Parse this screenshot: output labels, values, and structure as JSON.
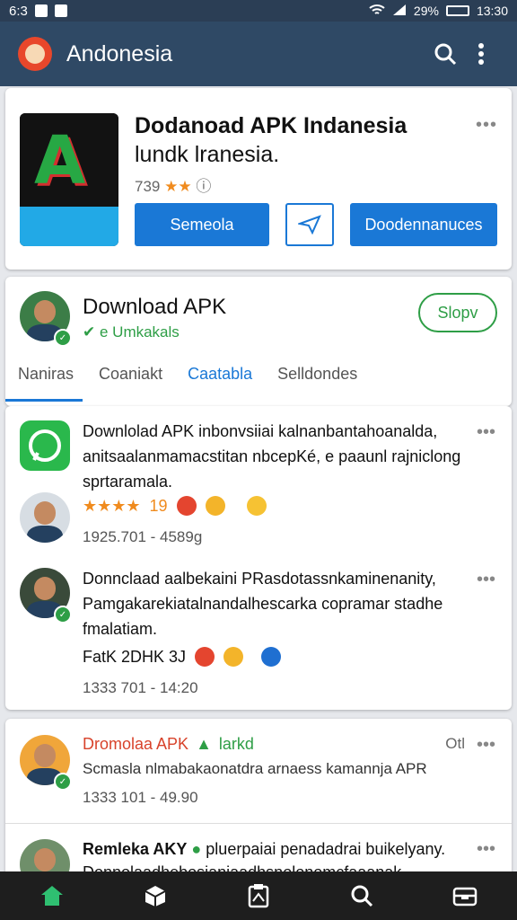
{
  "status_bar": {
    "left": "6:3",
    "battery": "29%",
    "time": "13:30"
  },
  "app_bar": {
    "title": "Andonesia"
  },
  "featured": {
    "title": "Dodanoad APK Indanesia",
    "subtitle": "lundk lranesia.",
    "rating_value": "739",
    "buttons": {
      "primary": "Semeola",
      "secondary": "Doodennanuces"
    }
  },
  "profile": {
    "name": "Download APK",
    "tag": "e Umkakals",
    "follow_label": "Slopv",
    "tabs": [
      "Naniras",
      "Coaniakt",
      "Caatabla",
      "Selldondes"
    ]
  },
  "posts": [
    {
      "text": "Downlolad APK inbonvsiiai kalnanbantahoanalda, anitsaalanmamacstitan nbcepKé, e paaunl rajniclong sprtaramala.",
      "rating_num": "19",
      "meta": "1925.701 - 4589g"
    },
    {
      "text": "Donnclaad aalbekaini PRasdotassnkaminenanity, Pamgakarekiatalnandalhescarka copramar stadhe fmalatiam.",
      "reaction_label": "FatK 2DHK 3J",
      "meta": "1333 701 - 14:20"
    },
    {
      "title": "Dromolaa APK",
      "tag": "larkd",
      "extra": "Otl",
      "text": "Scmasla nlmabakaonatdra arnaess kamannja APR",
      "meta": "1333 101 - 49.90"
    },
    {
      "title": "Remleka AKY",
      "text": "pluerpaiai penadadrai buikelyany. Donnolaadhebosianiaadhsnolonomcfaaanak"
    }
  ],
  "colors": {
    "accent": "#1a78d6",
    "appbar": "#2f4965",
    "success": "#2e9e46",
    "star": "#f08b1e"
  }
}
